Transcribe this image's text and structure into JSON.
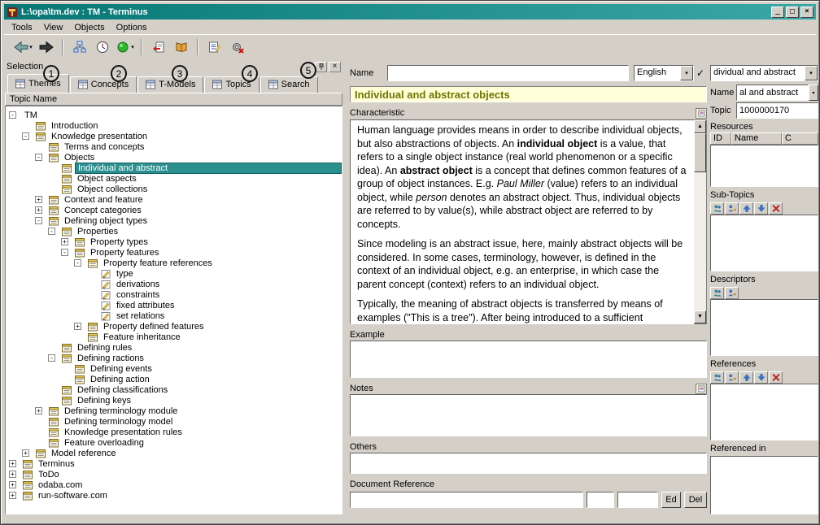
{
  "window": {
    "title": "L:\\opa\\tm.dev : TM - Terminus",
    "controls": [
      "_",
      "□",
      "×"
    ]
  },
  "icons": {
    "caret": "▾",
    "check": "✓",
    "scroll_up": "▲",
    "scroll_down": "▼",
    "close": "×"
  },
  "menu": {
    "items": [
      "Tools",
      "View",
      "Objects",
      "Options"
    ]
  },
  "toolbar": {
    "items": [
      {
        "name": "back",
        "caret": true
      },
      {
        "name": "forward"
      },
      {
        "sep": true
      },
      {
        "name": "hierarchy"
      },
      {
        "name": "overview"
      },
      {
        "name": "status",
        "caret": true
      },
      {
        "sep": true
      },
      {
        "name": "checkout"
      },
      {
        "name": "refresh"
      },
      {
        "sep": true
      },
      {
        "name": "edit-list"
      },
      {
        "name": "process"
      }
    ]
  },
  "selection": {
    "title": "Selection",
    "tabs": [
      {
        "label": "Themes"
      },
      {
        "label": "Concepts"
      },
      {
        "label": "T-Models"
      },
      {
        "label": "Topics"
      },
      {
        "label": "Search"
      }
    ],
    "annotations": [
      "1",
      "2",
      "3",
      "4",
      "5"
    ],
    "tree_header": "Topic Name",
    "tree": [
      {
        "l": "TM",
        "d": 0,
        "e": "-"
      },
      {
        "l": "Introduction",
        "d": 1,
        "i": "t"
      },
      {
        "l": "Knowledge presentation",
        "d": 1,
        "e": "-",
        "i": "t"
      },
      {
        "l": "Terms and concepts",
        "d": 2,
        "i": "t"
      },
      {
        "l": "Objects",
        "d": 2,
        "e": "-",
        "i": "t"
      },
      {
        "l": "Individual and abstract",
        "d": 3,
        "i": "t",
        "s": true
      },
      {
        "l": "Object aspects",
        "d": 3,
        "i": "t"
      },
      {
        "l": "Object collections",
        "d": 3,
        "i": "t"
      },
      {
        "l": "Context and feature",
        "d": 2,
        "e": "+",
        "i": "t"
      },
      {
        "l": "Concept categories",
        "d": 2,
        "e": "+",
        "i": "t"
      },
      {
        "l": "Defining object types",
        "d": 2,
        "e": "-",
        "i": "t"
      },
      {
        "l": "Properties",
        "d": 3,
        "e": "-",
        "i": "t"
      },
      {
        "l": "Property types",
        "d": 4,
        "e": "+",
        "i": "t"
      },
      {
        "l": "Property features",
        "d": 4,
        "e": "-",
        "i": "t"
      },
      {
        "l": "Property feature references",
        "d": 5,
        "e": "-",
        "i": "t"
      },
      {
        "l": "type",
        "d": 6,
        "i": "f"
      },
      {
        "l": "derivations",
        "d": 6,
        "i": "f"
      },
      {
        "l": "constraints",
        "d": 6,
        "i": "f"
      },
      {
        "l": "fixed attributes",
        "d": 6,
        "i": "f"
      },
      {
        "l": "set relations",
        "d": 6,
        "i": "f"
      },
      {
        "l": "Property defined features",
        "d": 5,
        "e": "+",
        "i": "t"
      },
      {
        "l": "Feature inheritance",
        "d": 5,
        "i": "t"
      },
      {
        "l": "Defining rules",
        "d": 3,
        "i": "t"
      },
      {
        "l": "Defining ractions",
        "d": 3,
        "e": "-",
        "i": "t"
      },
      {
        "l": "Defining events",
        "d": 4,
        "i": "t"
      },
      {
        "l": "Defining action",
        "d": 4,
        "i": "t"
      },
      {
        "l": "Defining classifications",
        "d": 3,
        "i": "t"
      },
      {
        "l": "Defining keys",
        "d": 3,
        "i": "t"
      },
      {
        "l": "Defining terminology module",
        "d": 2,
        "e": "+",
        "i": "t"
      },
      {
        "l": "Defining terminology model",
        "d": 2,
        "i": "t"
      },
      {
        "l": "Knowledge presentation rules",
        "d": 2,
        "i": "t"
      },
      {
        "l": "Feature overloading",
        "d": 2,
        "i": "t"
      },
      {
        "l": "Model reference",
        "d": 1,
        "e": "+",
        "i": "t"
      },
      {
        "l": "Terminus",
        "d": 0,
        "e": "+",
        "i": "t"
      },
      {
        "l": "ToDo",
        "d": 0,
        "e": "+",
        "i": "t"
      },
      {
        "l": "odaba.com",
        "d": 0,
        "e": "+",
        "i": "t"
      },
      {
        "l": "run-software.com",
        "d": 0,
        "e": "+",
        "i": "t"
      }
    ]
  },
  "editor": {
    "name_label": "Name",
    "name_value": "",
    "language": "English",
    "title": "Individual and abstract objects",
    "characteristic_label": "Characteristic",
    "characteristic": [
      [
        {
          "t": "Human language provides means in order to describe individual objects, but also abstractions of objects. An "
        },
        {
          "t": "individual object",
          "b": true
        },
        {
          "t": " is a value, that refers to a single object instance (real world phenomenon or a specific idea). An "
        },
        {
          "t": "abstract object",
          "b": true
        },
        {
          "t": " is a concept that defines common features of a group of object instances. E.g. "
        },
        {
          "t": "Paul Miller",
          "i": true
        },
        {
          "t": " (value) refers to an individual object, while "
        },
        {
          "t": "person",
          "i": true
        },
        {
          "t": " denotes an abstract object. Thus, individual objects are referred to by value(s), while abstract object are referred to by concepts."
        }
      ],
      [
        {
          "t": "Since modeling is an abstract issue, here, mainly abstract objects will be considered. In some cases, terminology, however, is defined in the context of an individual object, e.g. an enterprise, in which case the parent concept (context) refers to an individual object."
        }
      ],
      [
        {
          "t": "Typically, the meaning of abstract objects is transferred by means of examples (\"This is a tree\"). After being introduced to a sufficient"
        }
      ]
    ],
    "example_label": "Example",
    "example_value": "",
    "notes_label": "Notes",
    "notes_value": "",
    "others_label": "Others",
    "others_value": "",
    "docref_label": "Document Reference",
    "docref_value": "",
    "docref_field2": "",
    "docref_field3": "",
    "edit_button": "Ed",
    "del_button": "Del"
  },
  "sidebar": {
    "topic_combo": "dividual and abstract",
    "name_label": "Name",
    "name_value": "al and abstract",
    "topic_label": "Topic",
    "topic_value": "1000000170",
    "resources_label": "Resources",
    "resources_columns": [
      "ID",
      "Name",
      "C"
    ],
    "subtopics_label": "Sub-Topics",
    "subtopics_icons": [
      "add",
      "link",
      "up",
      "down",
      "delete"
    ],
    "descriptors_label": "Descriptors",
    "descriptors_icons": [
      "add",
      "link"
    ],
    "references_label": "References",
    "references_icons": [
      "add",
      "link",
      "up",
      "down",
      "delete"
    ],
    "referenced_in_label": "Referenced in"
  }
}
